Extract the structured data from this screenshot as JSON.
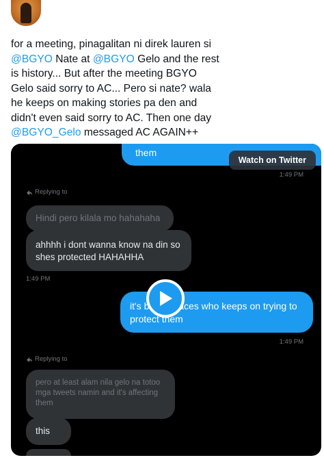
{
  "tweet": {
    "line1": "for a meeting, pinagalitan ni direk lauren si",
    "mention_nate": "@BGYO",
    "text_nate": " Nate at ",
    "mention_gelo": "@BGYO",
    "text_gelo": " Gelo and the rest",
    "line3": "is history... But after the meeting BGYO",
    "line4": "Gelo said sorry to AC... Pero si nate? wala",
    "line5": "he keeps on making stories pa den and",
    "line6": "didn't even said sorry to AC. Then one day",
    "mention_gelo2": "@BGYO_Gelo",
    "text_end": " messaged AC AGAIN++"
  },
  "media": {
    "watch_label": "Watch on Twitter",
    "messages": {
      "out_top": "them",
      "ts_1": "1:49 PM",
      "replying_1": "Replying to",
      "in_quote_1": "Hindi pero kilala mo hahahaha",
      "in_1": "ahhhh i dont wanna know na din so shes protected HAHAHHA",
      "ts_2": "1:49 PM",
      "out_2": "it's bobong aces who keeps on trying to protect them",
      "ts_3": "1:49 PM",
      "replying_2": "Replying to",
      "in_quote_2": "pero at least alam nila gelo na totoo mga tweets namin and it's affecting them",
      "in_2": "this"
    }
  },
  "colors": {
    "accent": "#1d9bf0",
    "incoming": "#2f3336",
    "media_bg": "#000000"
  }
}
